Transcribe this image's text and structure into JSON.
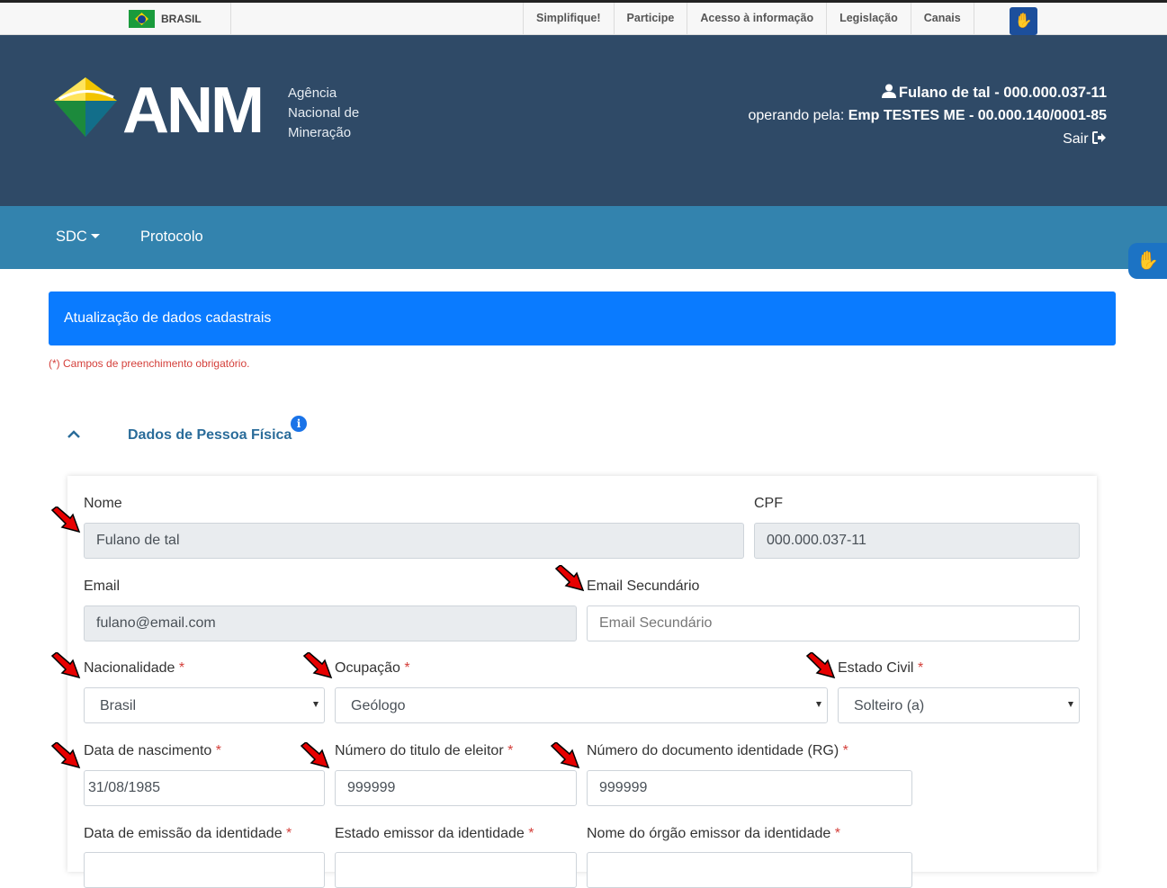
{
  "govbar": {
    "country": "BRASIL",
    "links": [
      "Simplifique!",
      "Participe",
      "Acesso à informação",
      "Legislação",
      "Canais"
    ],
    "accessibility_icon": "vlibras-hand-icon"
  },
  "header": {
    "logo_text": "ANM",
    "logo_sub": [
      "Agência",
      "Nacional de",
      "Mineração"
    ],
    "user_name": "Fulano de tal",
    "user_cpf": "000.000.037-11",
    "operating_label": "operando pela:",
    "company": "Emp TESTES ME",
    "company_cnpj": "00.000.140/0001-85",
    "logout": "Sair"
  },
  "nav": {
    "items": [
      "SDC",
      "Protocolo"
    ]
  },
  "page": {
    "title": "Atualização de dados cadastrais",
    "required_note": "(*) Campos de preenchimento obrigatório.",
    "section_title": "Dados de Pessoa Física"
  },
  "form": {
    "nome": {
      "label": "Nome",
      "value": "Fulano de tal"
    },
    "cpf": {
      "label": "CPF",
      "value": "000.000.037-11"
    },
    "email": {
      "label": "Email",
      "value": "fulano@email.com"
    },
    "email2": {
      "label": "Email Secundário",
      "placeholder": "Email Secundário"
    },
    "nacionalidade": {
      "label": "Nacionalidade",
      "value": "Brasil"
    },
    "ocupacao": {
      "label": "Ocupação",
      "value": "Geólogo"
    },
    "estado_civil": {
      "label": "Estado Civil",
      "value": "Solteiro (a)"
    },
    "nascimento": {
      "label": "Data de nascimento",
      "value": "31/08/1985"
    },
    "titulo": {
      "label": "Número do titulo de eleitor",
      "value": "999999"
    },
    "rg": {
      "label": "Número do documento identidade (RG)",
      "value": "999999"
    },
    "emissao": {
      "label": "Data de emissão da identidade"
    },
    "estado_emissor": {
      "label": "Estado emissor da identidade"
    },
    "orgao_emissor": {
      "label": "Nome do órgão emissor da identidade"
    },
    "required_mark": "*"
  },
  "colors": {
    "header_bg": "#2f4a67",
    "nav_bg": "#3383ae",
    "title_bar": "#0a7bff",
    "required": "#d43f3a",
    "annotation_arrow": "#e60000"
  }
}
